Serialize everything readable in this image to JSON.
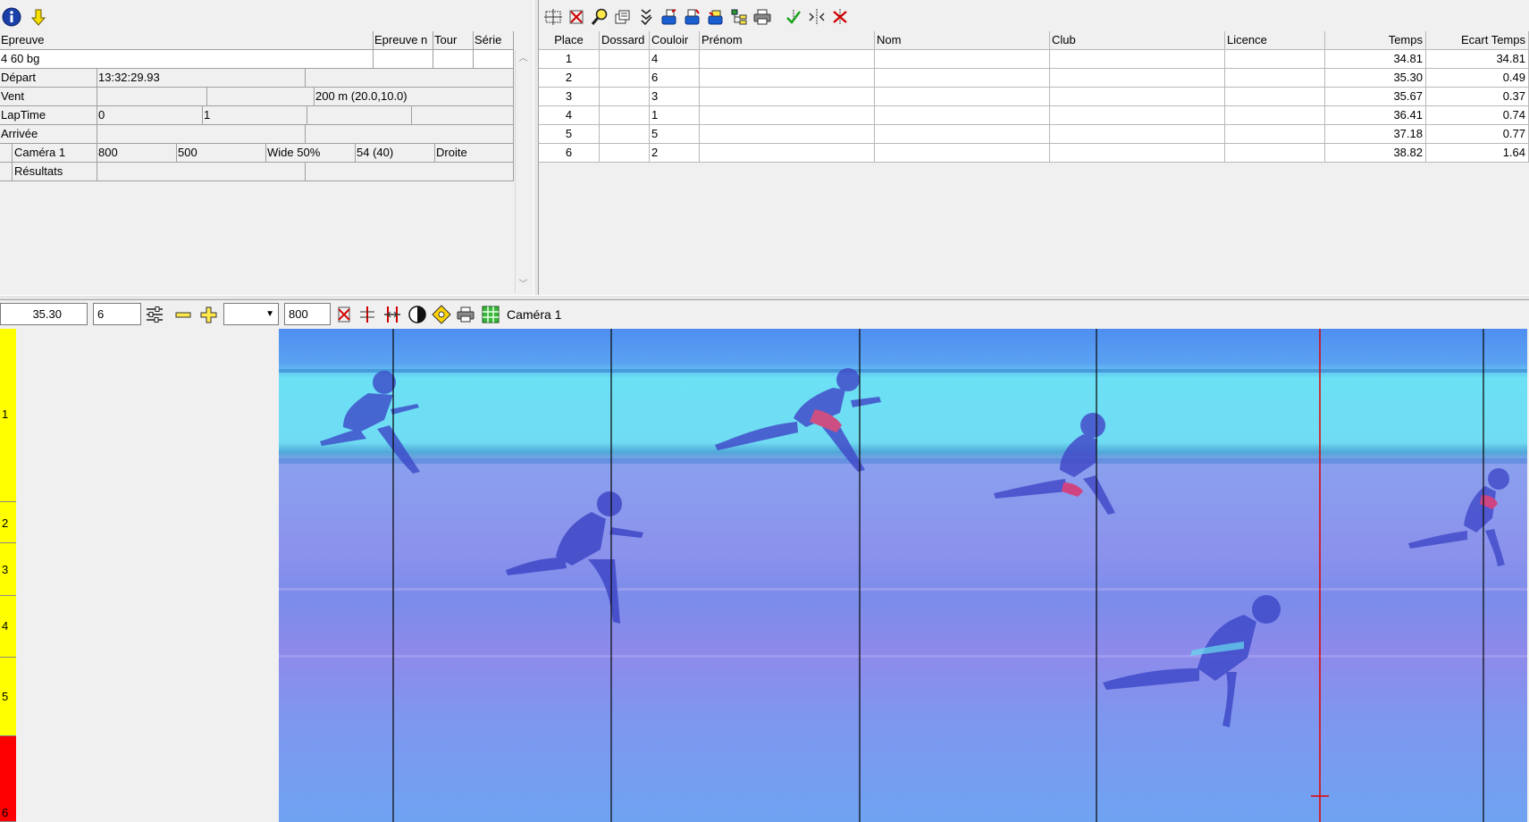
{
  "event_panel": {
    "header": {
      "epreuve": "Epreuve",
      "epreuve_n": "Epreuve n",
      "tour": "Tour",
      "serie": "Série"
    },
    "event_name": "4 60 bg",
    "depart": {
      "label": "Départ",
      "time": "13:32:29.93"
    },
    "vent": {
      "label": "Vent",
      "value": "200 m (20.0,10.0)"
    },
    "laptime": {
      "label": "LapTime",
      "v1": "0",
      "v2": "1"
    },
    "arrivee": {
      "label": "Arrivée"
    },
    "camera": {
      "label": "Caméra 1",
      "v1": "800",
      "v2": "500",
      "mode": "Wide 50%",
      "v3": "54  (40)",
      "side": "Droite"
    },
    "resultats": {
      "label": "Résultats"
    }
  },
  "results_table": {
    "columns": [
      "Place",
      "Dossard",
      "Couloir",
      "Prénom",
      "Nom",
      "Club",
      "Licence",
      "Temps",
      "Ecart Temps"
    ],
    "rows": [
      {
        "place": "1",
        "dossard": "",
        "couloir": "4",
        "prenom": "",
        "nom": "",
        "club": "",
        "licence": "",
        "temps": "34.81",
        "ecart": "34.81"
      },
      {
        "place": "2",
        "dossard": "",
        "couloir": "6",
        "prenom": "",
        "nom": "",
        "club": "",
        "licence": "",
        "temps": "35.30",
        "ecart": "0.49"
      },
      {
        "place": "3",
        "dossard": "",
        "couloir": "3",
        "prenom": "",
        "nom": "",
        "club": "",
        "licence": "",
        "temps": "35.67",
        "ecart": "0.37"
      },
      {
        "place": "4",
        "dossard": "",
        "couloir": "1",
        "prenom": "",
        "nom": "",
        "club": "",
        "licence": "",
        "temps": "36.41",
        "ecart": "0.74"
      },
      {
        "place": "5",
        "dossard": "",
        "couloir": "5",
        "prenom": "",
        "nom": "",
        "club": "",
        "licence": "",
        "temps": "37.18",
        "ecart": "0.77"
      },
      {
        "place": "6",
        "dossard": "",
        "couloir": "2",
        "prenom": "",
        "nom": "",
        "club": "",
        "licence": "",
        "temps": "38.82",
        "ecart": "1.64"
      }
    ]
  },
  "image_toolbar": {
    "time": "35.30",
    "lane_value": "6",
    "combo_value": "",
    "zoom_value": "800",
    "camera_label": "Caméra 1"
  },
  "lanes": [
    {
      "label": "1",
      "color": "#ffff00"
    },
    {
      "label": "2",
      "color": "#ffff00"
    },
    {
      "label": "3",
      "color": "#ffff00"
    },
    {
      "label": "4",
      "color": "#ffff00"
    },
    {
      "label": "5",
      "color": "#ffff00"
    },
    {
      "label": "6",
      "color": "#ff0000"
    }
  ],
  "colors": {
    "track_blue": "#6f8ff0",
    "sky_cyan": "#6ce0f5",
    "cursor_red": "#e00000"
  }
}
